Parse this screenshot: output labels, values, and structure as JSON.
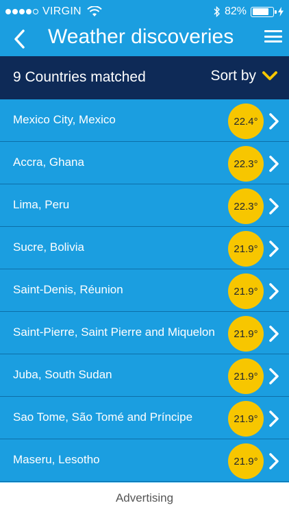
{
  "status_bar": {
    "carrier": "VIRGIN",
    "battery": "82%",
    "signal_bars_filled": 4,
    "signal_bars_total": 5
  },
  "nav": {
    "title": "Weather discoveries",
    "back_icon": "chevron-left-icon",
    "menu_icon": "hamburger-menu-icon"
  },
  "results": {
    "count_label": "9 Countries matched",
    "sort_label": "Sort by",
    "sort_icon": "chevron-down-icon"
  },
  "list": [
    {
      "place": "Mexico City, Mexico",
      "temp": "22.4°"
    },
    {
      "place": "Accra, Ghana",
      "temp": "22.3°"
    },
    {
      "place": "Lima, Peru",
      "temp": "22.3°"
    },
    {
      "place": "Sucre, Bolivia",
      "temp": "21.9°"
    },
    {
      "place": "Saint-Denis, Réunion",
      "temp": "21.9°"
    },
    {
      "place": "Saint-Pierre, Saint Pierre and Miquelon",
      "temp": "21.9°"
    },
    {
      "place": "Juba, South Sudan",
      "temp": "21.9°"
    },
    {
      "place": "Sao Tome, São Tomé and Príncipe",
      "temp": "21.9°"
    },
    {
      "place": "Maseru, Lesotho",
      "temp": "21.9°"
    }
  ],
  "footer": {
    "ad_label": "Advertising"
  },
  "colors": {
    "background": "#1b9ee0",
    "header": "#0e2a57",
    "temp_badge": "#f7c600",
    "accent": "#f7c600"
  }
}
